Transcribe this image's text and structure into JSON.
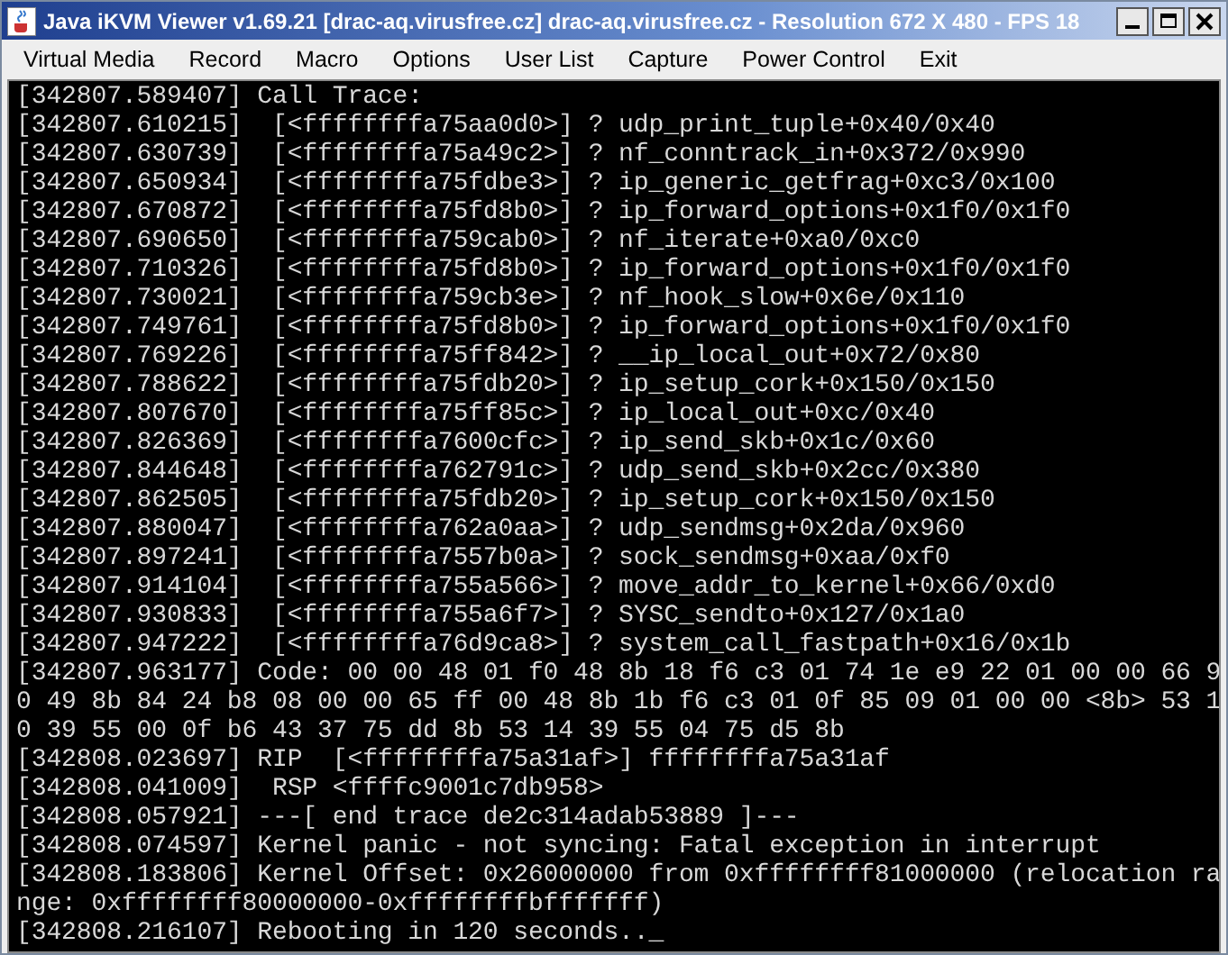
{
  "window": {
    "title": "Java iKVM Viewer v1.69.21 [drac-aq.virusfree.cz] drac-aq.virusfree.cz - Resolution 672 X 480 - FPS 18"
  },
  "menu": [
    "Virtual Media",
    "Record",
    "Macro",
    "Options",
    "User List",
    "Capture",
    "Power Control",
    "Exit"
  ],
  "console_lines": [
    "[342807.589407] Call Trace:",
    "[342807.610215]  [<ffffffffa75aa0d0>] ? udp_print_tuple+0x40/0x40",
    "[342807.630739]  [<ffffffffa75a49c2>] ? nf_conntrack_in+0x372/0x990",
    "[342807.650934]  [<ffffffffa75fdbe3>] ? ip_generic_getfrag+0xc3/0x100",
    "[342807.670872]  [<ffffffffa75fd8b0>] ? ip_forward_options+0x1f0/0x1f0",
    "[342807.690650]  [<ffffffffa759cab0>] ? nf_iterate+0xa0/0xc0",
    "[342807.710326]  [<ffffffffa75fd8b0>] ? ip_forward_options+0x1f0/0x1f0",
    "[342807.730021]  [<ffffffffa759cb3e>] ? nf_hook_slow+0x6e/0x110",
    "[342807.749761]  [<ffffffffa75fd8b0>] ? ip_forward_options+0x1f0/0x1f0",
    "[342807.769226]  [<ffffffffa75ff842>] ? __ip_local_out+0x72/0x80",
    "[342807.788622]  [<ffffffffa75fdb20>] ? ip_setup_cork+0x150/0x150",
    "[342807.807670]  [<ffffffffa75ff85c>] ? ip_local_out+0xc/0x40",
    "[342807.826369]  [<ffffffffa7600cfc>] ? ip_send_skb+0x1c/0x60",
    "[342807.844648]  [<ffffffffa762791c>] ? udp_send_skb+0x2cc/0x380",
    "[342807.862505]  [<ffffffffa75fdb20>] ? ip_setup_cork+0x150/0x150",
    "[342807.880047]  [<ffffffffa762a0aa>] ? udp_sendmsg+0x2da/0x960",
    "[342807.897241]  [<ffffffffa7557b0a>] ? sock_sendmsg+0xaa/0xf0",
    "[342807.914104]  [<ffffffffa755a566>] ? move_addr_to_kernel+0x66/0xd0",
    "[342807.930833]  [<ffffffffa755a6f7>] ? SYSC_sendto+0x127/0x1a0",
    "[342807.947222]  [<ffffffffa76d9ca8>] ? system_call_fastpath+0x16/0x1b",
    "[342807.963177] Code: 00 00 48 01 f0 48 8b 18 f6 c3 01 74 1e e9 22 01 00 00 66 9",
    "0 49 8b 84 24 b8 08 00 00 65 ff 00 48 8b 1b f6 c3 01 0f 85 09 01 00 00 <8b> 53 1",
    "0 39 55 00 0f b6 43 37 75 dd 8b 53 14 39 55 04 75 d5 8b",
    "[342808.023697] RIP  [<ffffffffa75a31af>] ffffffffa75a31af",
    "[342808.041009]  RSP <ffffc9001c7db958>",
    "[342808.057921] ---[ end trace de2c314adab53889 ]---",
    "[342808.074597] Kernel panic - not syncing: Fatal exception in interrupt",
    "[342808.183806] Kernel Offset: 0x26000000 from 0xffffffff81000000 (relocation ra",
    "nge: 0xffffffff80000000-0xffffffffbfffffff)",
    "[342808.216107] Rebooting in 120 seconds.._"
  ]
}
